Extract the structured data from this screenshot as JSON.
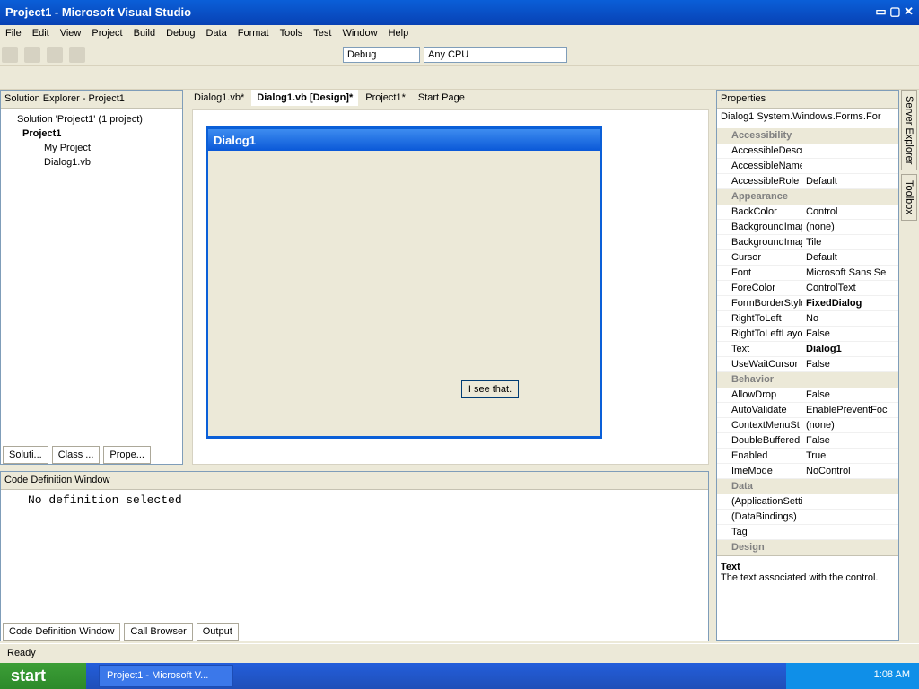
{
  "window": {
    "title": "Project1 - Microsoft Visual Studio"
  },
  "menu": [
    "File",
    "Edit",
    "View",
    "Project",
    "Build",
    "Debug",
    "Data",
    "Format",
    "Tools",
    "Test",
    "Window",
    "Help"
  ],
  "toolbar": {
    "config": "Debug",
    "platform": "Any CPU"
  },
  "solution": {
    "title": "Solution Explorer - Project1",
    "items": [
      "Solution 'Project1' (1 project)",
      "Project1",
      "My Project",
      "Dialog1.vb"
    ]
  },
  "doc_tabs": [
    "Dialog1.vb*",
    "Dialog1.vb [Design]*",
    "Project1*",
    "Start Page"
  ],
  "designer": {
    "dialog_title": "Dialog1",
    "button_label": "I see that."
  },
  "bottom_panel": {
    "title": "Code Definition Window",
    "text": "No definition selected",
    "tabs": [
      "Code Definition Window",
      "Call Browser",
      "Output"
    ]
  },
  "left_tabs": [
    "Soluti...",
    "Class ...",
    "Prope..."
  ],
  "properties": {
    "title": "Properties",
    "object": "Dialog1 System.Windows.Forms.For",
    "rows": [
      {
        "cat": "Accessibility"
      },
      {
        "k": "AccessibleDescri",
        "v": ""
      },
      {
        "k": "AccessibleName",
        "v": ""
      },
      {
        "k": "AccessibleRole",
        "v": "Default"
      },
      {
        "cat": "Appearance"
      },
      {
        "k": "BackColor",
        "v": "Control"
      },
      {
        "k": "BackgroundImag",
        "v": "(none)"
      },
      {
        "k": "BackgroundImag",
        "v": "Tile"
      },
      {
        "k": "Cursor",
        "v": "Default"
      },
      {
        "k": "Font",
        "v": "Microsoft Sans Se"
      },
      {
        "k": "ForeColor",
        "v": "ControlText"
      },
      {
        "k": "FormBorderStyle",
        "v": "FixedDialog"
      },
      {
        "k": "RightToLeft",
        "v": "No"
      },
      {
        "k": "RightToLeftLayo",
        "v": "False"
      },
      {
        "k": "Text",
        "v": "Dialog1"
      },
      {
        "k": "UseWaitCursor",
        "v": "False"
      },
      {
        "cat": "Behavior"
      },
      {
        "k": "AllowDrop",
        "v": "False"
      },
      {
        "k": "AutoValidate",
        "v": "EnablePreventFoc"
      },
      {
        "k": "ContextMenuSt",
        "v": "(none)"
      },
      {
        "k": "DoubleBuffered",
        "v": "False"
      },
      {
        "k": "Enabled",
        "v": "True"
      },
      {
        "k": "ImeMode",
        "v": "NoControl"
      },
      {
        "cat": "Data"
      },
      {
        "k": "(ApplicationSetti",
        "v": ""
      },
      {
        "k": "(DataBindings)",
        "v": ""
      },
      {
        "k": "Tag",
        "v": ""
      },
      {
        "cat": "Design"
      }
    ],
    "desc_title": "Text",
    "desc_text": "The text associated with the control."
  },
  "right_vertical_tabs": [
    "Server Explorer",
    "Toolbox"
  ],
  "status": "Ready",
  "taskbar": {
    "start": "start",
    "task": "Project1 - Microsoft V...",
    "time": "1:08 AM"
  }
}
